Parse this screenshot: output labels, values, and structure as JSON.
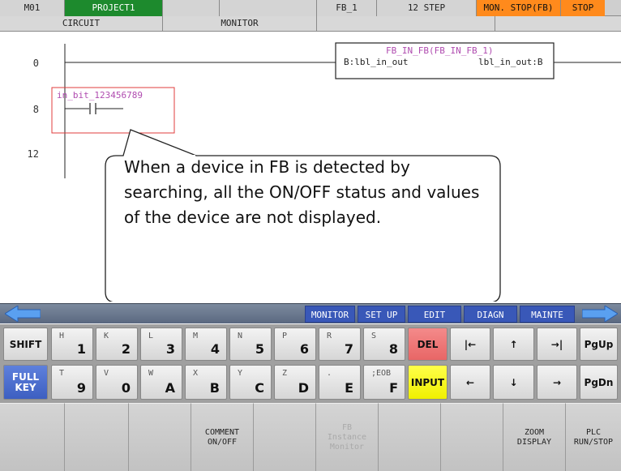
{
  "header": {
    "device": "M01",
    "project": "PROJECT1",
    "fb_name": "FB_1",
    "step": "12 STEP",
    "mode": "MON. STOP(FB)",
    "status": "STOP"
  },
  "subheader": {
    "circuit": "CIRCUIT",
    "monitor": "MONITOR"
  },
  "ladder": {
    "step_numbers": [
      "0",
      "8",
      "12"
    ],
    "fb_block": {
      "title": "FB_IN_FB(FB_IN_FB_1)",
      "input_label": "B:lbl_in_out",
      "output_label": "lbl_in_out:B"
    },
    "contact": {
      "label": "in_bit_123456789"
    }
  },
  "callout": {
    "text": "When a device in FB is detected by searching, all the ON/OFF status and values of the device are not displayed."
  },
  "tabs": [
    "MONITOR",
    "SET UP",
    "EDIT",
    "DIAGN",
    "MAINTE"
  ],
  "keyboard": {
    "shift": "SHIFT",
    "full_key": "FULL KEY",
    "row1": [
      {
        "small": "H",
        "big": "1"
      },
      {
        "small": "K",
        "big": "2"
      },
      {
        "small": "L",
        "big": "3"
      },
      {
        "small": "M",
        "big": "4"
      },
      {
        "small": "N",
        "big": "5"
      },
      {
        "small": "P",
        "big": "6"
      },
      {
        "small": "R",
        "big": "7"
      },
      {
        "small": "S",
        "big": "8"
      }
    ],
    "row2": [
      {
        "small": "T",
        "big": "9"
      },
      {
        "small": "V",
        "big": "0"
      },
      {
        "small": "W",
        "big": "A"
      },
      {
        "small": "X",
        "big": "B"
      },
      {
        "small": "Y",
        "big": "C"
      },
      {
        "small": "Z",
        "big": "D"
      },
      {
        "small": ".",
        "big": "E"
      },
      {
        "small": ";EOB",
        "big": "F"
      }
    ],
    "del": "DEL",
    "input": "INPUT",
    "home": "|←",
    "up": "↑",
    "end": "→|",
    "pgup": "PgUp",
    "left": "←",
    "down": "↓",
    "right": "→",
    "pgdn": "PgDn"
  },
  "softkeys": [
    "",
    "",
    "",
    "COMMENT\nON/OFF",
    "",
    "FB\nInstance\nMonitor",
    "",
    "",
    "ZOOM\nDISPLAY",
    "PLC\nRUN/STOP"
  ],
  "colors": {
    "project_bg": "#1d8a2d",
    "mode_bg": "#ff8a1c",
    "tab_bg": "#3958b8",
    "fb_title": "#b04cb0",
    "highlight_box": "#e03c3c",
    "del_key": "#e86666",
    "input_key": "#f0f000"
  }
}
